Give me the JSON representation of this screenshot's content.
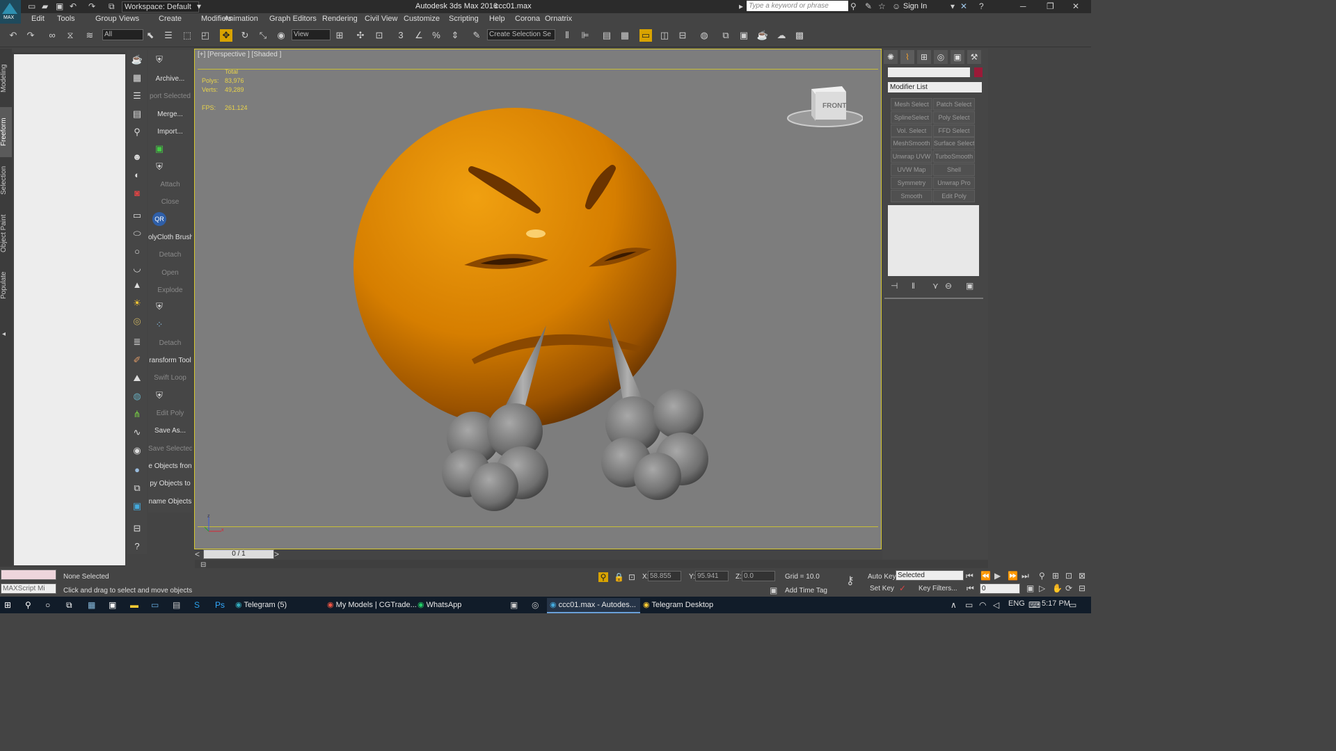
{
  "window": {
    "app_title": "Autodesk 3ds Max 2016",
    "file_name": "ccc01.max",
    "logo_label": "MAX",
    "workspace": "Workspace: Default",
    "search_placeholder": "Type a keyword or phrase",
    "sign_in": "Sign In"
  },
  "menu": [
    "Edit",
    "Tools",
    "Group",
    "Views",
    "Create",
    "Modifiers",
    "Animation",
    "Graph Editors",
    "Rendering",
    "Civil View",
    "Customize",
    "Scripting",
    "Help",
    "Corona",
    "Ornatrix"
  ],
  "toolbar": {
    "selection_filter": "All",
    "ref_coord": "View",
    "selection_set": "Create Selection Se"
  },
  "ribbon_tabs": [
    "Modeling",
    "Freeform",
    "Selection",
    "Object Paint",
    "Populate"
  ],
  "tool_labels": [
    {
      "label": "Archive...",
      "disabled": false
    },
    {
      "label": "port Selected",
      "disabled": true
    },
    {
      "label": "Merge...",
      "disabled": false
    },
    {
      "label": "Import...",
      "disabled": false
    },
    {
      "label": "Attach",
      "disabled": true
    },
    {
      "label": "Close",
      "disabled": true
    },
    {
      "label": "olyCloth Brush",
      "disabled": false
    },
    {
      "label": "Detach",
      "disabled": true
    },
    {
      "label": "Open",
      "disabled": true
    },
    {
      "label": "Explode",
      "disabled": true
    },
    {
      "label": "Detach",
      "disabled": true
    },
    {
      "label": "ransform Tool",
      "disabled": false
    },
    {
      "label": "Swift Loop",
      "disabled": true
    },
    {
      "label": "Edit Poly",
      "disabled": true
    },
    {
      "label": "Save As...",
      "disabled": false
    },
    {
      "label": "Save Selected",
      "disabled": true
    },
    {
      "label": "e Objects fron",
      "disabled": false
    },
    {
      "label": "py Objects to",
      "disabled": false
    },
    {
      "label": "name Objects",
      "disabled": false
    }
  ],
  "viewport": {
    "label": "[+] [Perspective ] [Shaded ]",
    "stats_header": "Total",
    "polys_label": "Polys:",
    "polys_value": "83,976",
    "verts_label": "Verts:",
    "verts_value": "49,289",
    "fps_label": "FPS:",
    "fps_value": "261.124",
    "viewcube_label": "FRONT"
  },
  "command_panel": {
    "modifier_list": "Modifier List",
    "swatch_color": "#9b1a38",
    "buttons": [
      "Mesh Select",
      "Patch Select",
      "SplineSelect",
      "Poly Select",
      "Vol. Select",
      "FFD Select",
      "MeshSmooth",
      "Surface Select",
      "Unwrap UVW",
      "TurboSmooth",
      "UVW Map",
      "Shell",
      "Symmetry",
      "Unwrap Pro",
      "Smooth",
      "Edit Poly"
    ]
  },
  "time": {
    "frame_indicator": "0 / 1"
  },
  "status": {
    "maxscript": "MAXScript Mi",
    "selection": "None Selected",
    "prompt": "Click and drag to select and move objects",
    "x_label": "X:",
    "x_value": "58.855",
    "y_label": "Y:",
    "y_value": "95.941",
    "z_label": "Z:",
    "z_value": "0.0",
    "grid": "Grid = 10.0",
    "add_time_tag": "Add Time Tag",
    "auto_key": "Auto Key",
    "set_key": "Set Key",
    "key_mode": "Selected",
    "key_filters": "Key Filters...",
    "current_frame": "0"
  },
  "taskbar": {
    "items": [
      {
        "label": "Telegram (5)",
        "active": false
      },
      {
        "label": "My Models | CGTrade...",
        "active": false
      },
      {
        "label": "WhatsApp",
        "active": false
      },
      {
        "label": "ccc01.max - Autodes...",
        "active": true
      },
      {
        "label": "Telegram Desktop",
        "active": false
      }
    ],
    "language": "ENG",
    "clock": "5:17 PM"
  },
  "colors": {
    "accent_yellow": "#d8a300",
    "emoji_orange": "#e08a00",
    "viewport_bg": "#7d7d7d"
  }
}
